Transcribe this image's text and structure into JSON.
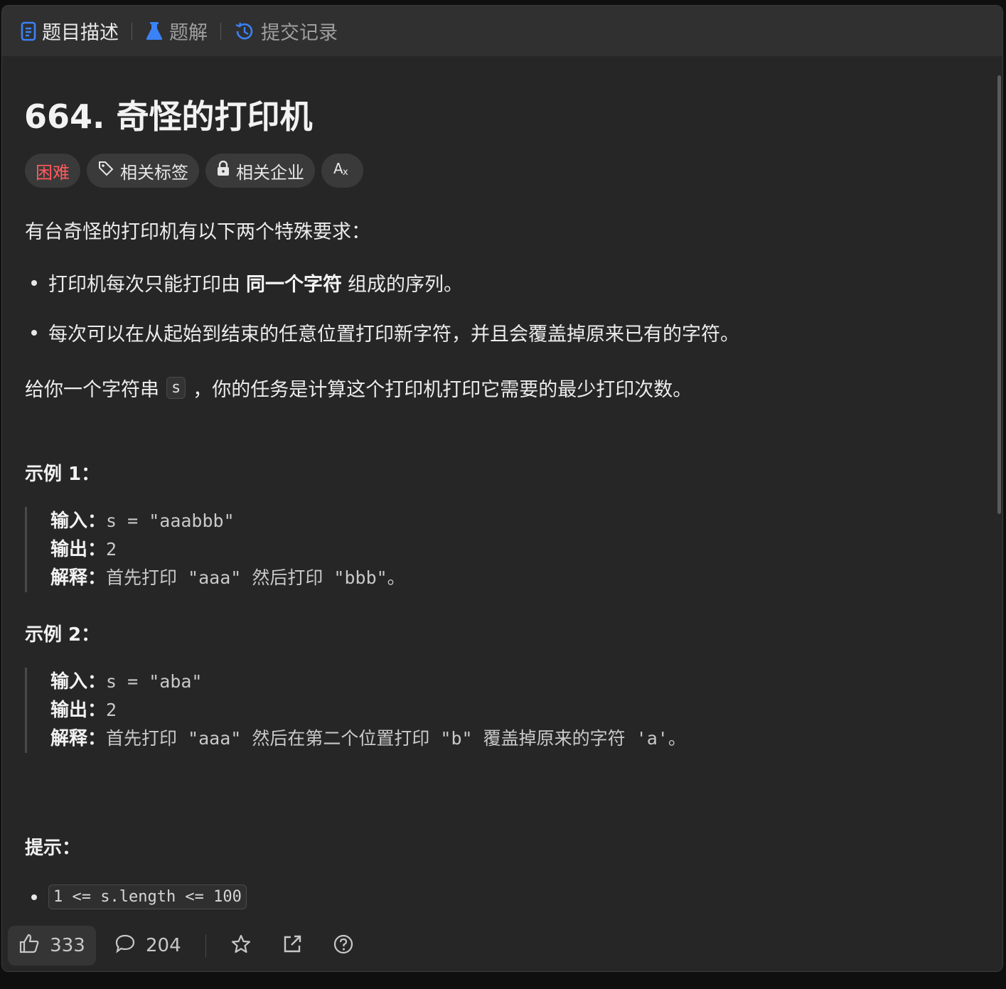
{
  "tabs": [
    {
      "label": "题目描述",
      "icon": "description-icon",
      "color": "#3b82f6"
    },
    {
      "label": "题解",
      "icon": "flask-icon",
      "color": "#3b82f6"
    },
    {
      "label": "提交记录",
      "icon": "history-icon",
      "color": "#3b82f6"
    }
  ],
  "problem": {
    "title": "664. 奇怪的打印机",
    "difficulty": "困难",
    "difficulty_color": "#ff5a5f",
    "chips": {
      "tags": "相关标签",
      "companies": "相关企业",
      "translate_icon": "translate-icon"
    },
    "intro": "有台奇怪的打印机有以下两个特殊要求：",
    "rule1": {
      "before": "打印机每次只能打印由",
      "bold": "同一个字符",
      "after": "组成的序列。"
    },
    "rule2": "每次可以在从起始到结束的任意位置打印新字符，并且会覆盖掉原来已有的字符。",
    "task": {
      "before": "给你一个字符串",
      "code": "s",
      "after": "，你的任务是计算这个打印机打印它需要的最少打印次数。"
    }
  },
  "examples": [
    {
      "title": "示例 1：",
      "input_label": "输入：",
      "input": "s = \"aaabbb\"",
      "output_label": "输出：",
      "output": "2",
      "explain_label": "解释：",
      "explain": "首先打印 \"aaa\" 然后打印 \"bbb\"。"
    },
    {
      "title": "示例 2：",
      "input_label": "输入：",
      "input": "s = \"aba\"",
      "output_label": "输出：",
      "output": "2",
      "explain_label": "解释：",
      "explain": "首先打印 \"aaa\" 然后在第二个位置打印 \"b\" 覆盖掉原来的字符 'a'。"
    }
  ],
  "hints": {
    "title": "提示：",
    "constraint": "1 <= s.length <= 100"
  },
  "bottom": {
    "likes": "333",
    "comments": "204"
  }
}
